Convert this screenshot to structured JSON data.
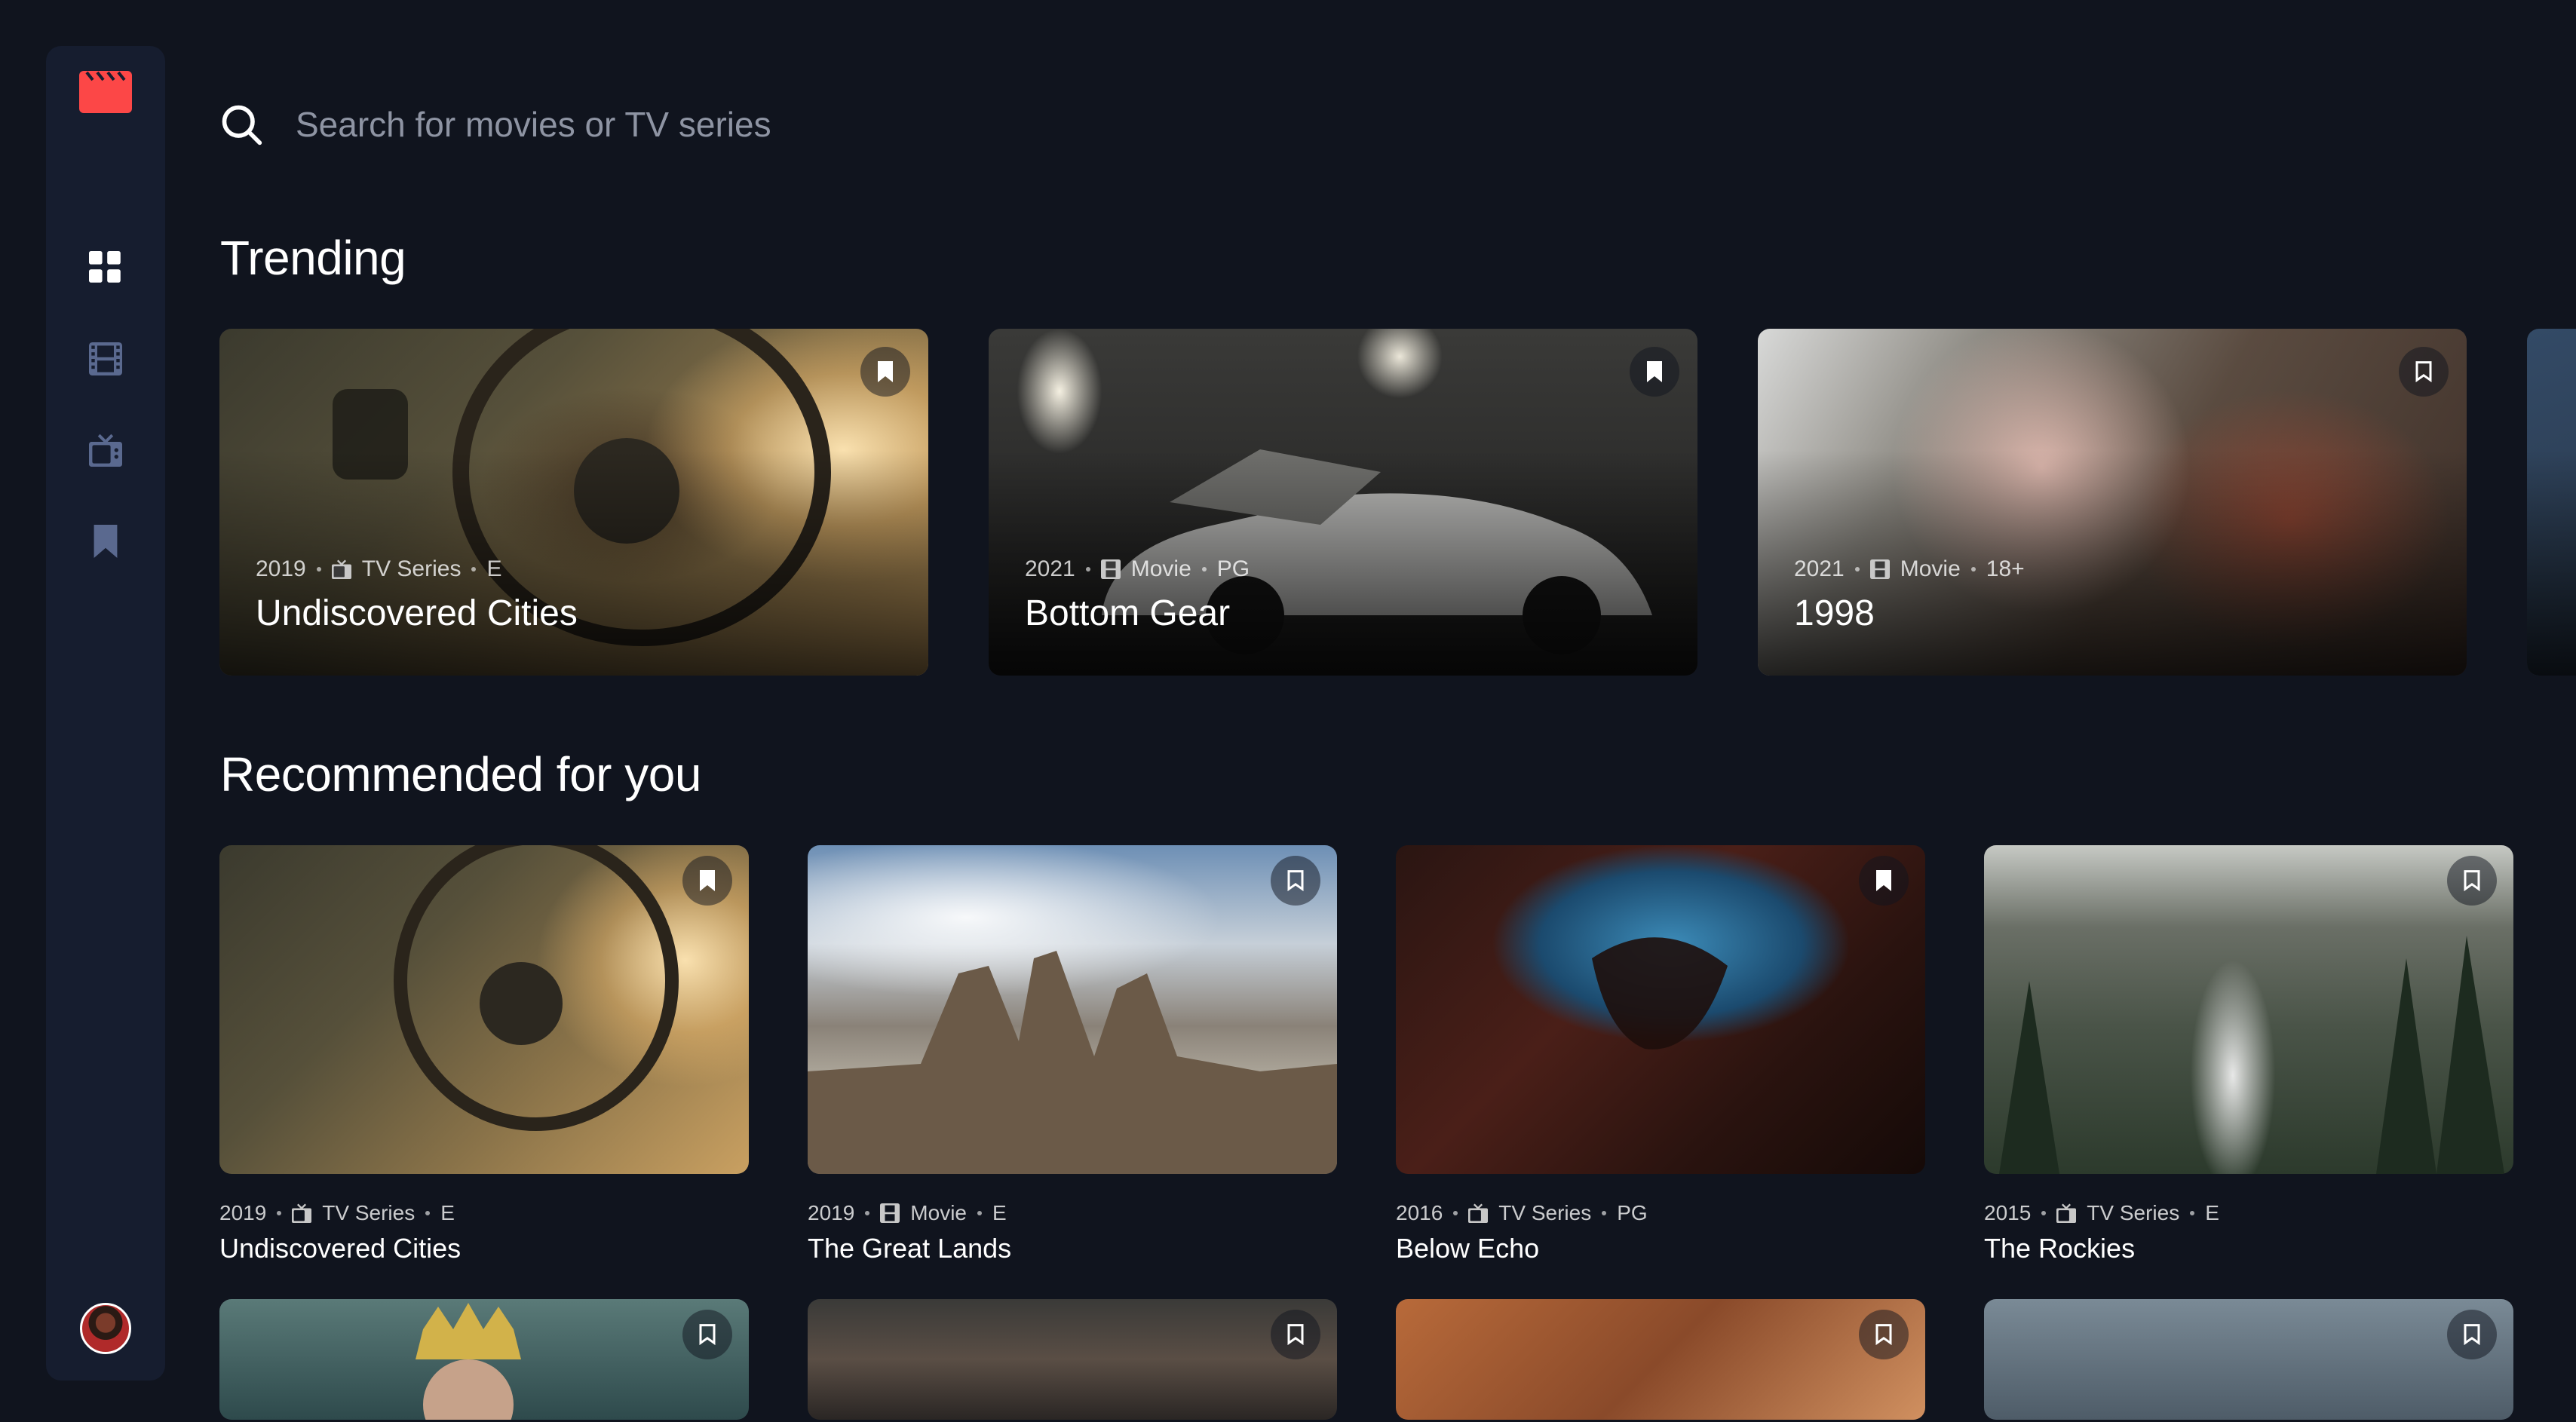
{
  "search": {
    "placeholder": "Search for movies or TV series",
    "value": ""
  },
  "sidebar": {
    "items": [
      {
        "name": "home",
        "active": true
      },
      {
        "name": "movies",
        "active": false
      },
      {
        "name": "tv-series",
        "active": false
      },
      {
        "name": "bookmarks",
        "active": false
      }
    ]
  },
  "colors": {
    "accent": "#FC4747",
    "background": "#10141E",
    "surface": "#161D2F",
    "muted": "#5A698F"
  },
  "trending": {
    "title": "Trending",
    "items": [
      {
        "year": "2019",
        "category": "TV Series",
        "rating": "E",
        "title": "Undiscovered Cities",
        "category_icon": "tv-icon"
      },
      {
        "year": "2021",
        "category": "Movie",
        "rating": "PG",
        "title": "Bottom Gear",
        "category_icon": "film-icon"
      },
      {
        "year": "2021",
        "category": "Movie",
        "rating": "18+",
        "title": "1998",
        "category_icon": "film-icon"
      }
    ]
  },
  "recommended": {
    "title": "Recommended for you",
    "items": [
      {
        "year": "2019",
        "category": "TV Series",
        "rating": "E",
        "title": "Undiscovered Cities",
        "category_icon": "tv-icon"
      },
      {
        "year": "2019",
        "category": "Movie",
        "rating": "E",
        "title": "The Great Lands",
        "category_icon": "film-icon"
      },
      {
        "year": "2016",
        "category": "TV Series",
        "rating": "PG",
        "title": "Below Echo",
        "category_icon": "tv-icon"
      },
      {
        "year": "2015",
        "category": "TV Series",
        "rating": "E",
        "title": "The Rockies",
        "category_icon": "tv-icon"
      }
    ]
  }
}
